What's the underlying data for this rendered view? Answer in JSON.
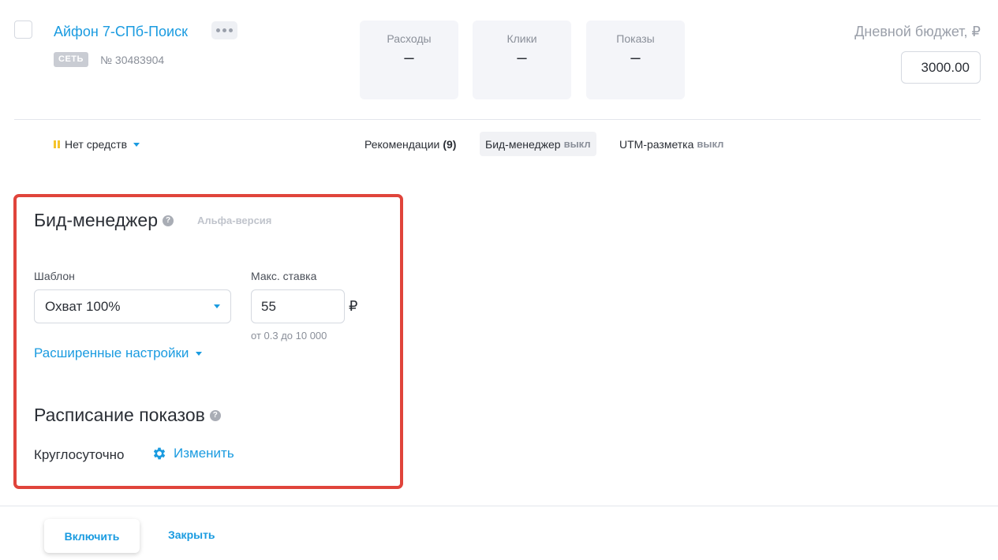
{
  "campaign": {
    "name": "Айфон 7-СПб-Поиск",
    "network_badge": "СЕТЬ",
    "id_text": "№ 30483904"
  },
  "stats": [
    {
      "label": "Расходы",
      "value": "–"
    },
    {
      "label": "Клики",
      "value": "–"
    },
    {
      "label": "Показы",
      "value": "–"
    }
  ],
  "budget": {
    "label": "Дневной бюджет, ₽",
    "value": "3000.00"
  },
  "status": {
    "text": "Нет средств"
  },
  "tabs": {
    "recommendations_label": "Рекомендации",
    "recommendations_count": "(9)",
    "bid_manager_label": "Бид-менеджер",
    "bid_manager_state": "выкл",
    "utm_label": "UTM-разметка",
    "utm_state": "выкл"
  },
  "bid_manager": {
    "title": "Бид-менеджер",
    "alpha": "Альфа-версия",
    "template_label": "Шаблон",
    "template_value": "Охват 100%",
    "max_bid_label": "Макс. ставка",
    "max_bid_value": "55",
    "currency": "₽",
    "range_hint": "от 0.3 до 10 000",
    "advanced_link": "Расширенные настройки"
  },
  "schedule": {
    "title": "Расписание показов",
    "value": "Круглосуточно",
    "change_link": "Изменить"
  },
  "footer": {
    "enable_label": "Включить",
    "close_label": "Закрыть"
  },
  "colors": {
    "accent": "#1a9be0",
    "highlight_border": "#e0443b",
    "status_pause": "#f5c42c"
  }
}
